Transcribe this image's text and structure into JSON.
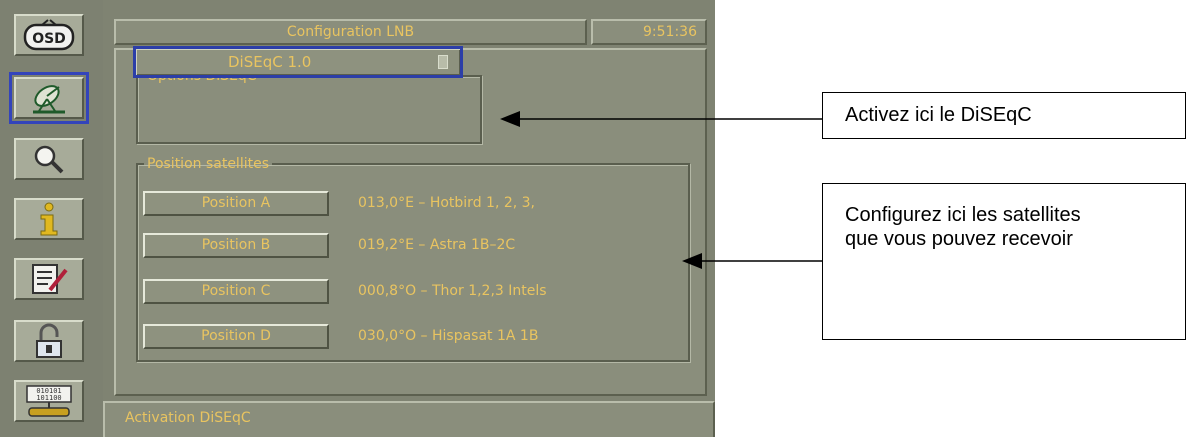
{
  "sidebar": {
    "items": [
      {
        "name": "osd-icon",
        "label": "OSD"
      },
      {
        "name": "satellite-dish-icon"
      },
      {
        "name": "magnifier-icon"
      },
      {
        "name": "info-icon"
      },
      {
        "name": "edit-document-icon"
      },
      {
        "name": "lock-icon"
      },
      {
        "name": "data-transfer-icon"
      }
    ],
    "selected_index": 1
  },
  "header": {
    "title": "Configuration LNB",
    "clock": "9:51:36"
  },
  "diseqc": {
    "group_label": "Options DiSEqC",
    "selected_value": "DiSEqC 1.0"
  },
  "positions": {
    "group_label": "Position satellites",
    "items": [
      {
        "button": "Position A",
        "satellite": "013,0°E – Hotbird 1, 2, 3,"
      },
      {
        "button": "Position B",
        "satellite": "019,2°E – Astra 1B–2C"
      },
      {
        "button": "Position C",
        "satellite": "000,8°O – Thor 1,2,3 Intels"
      },
      {
        "button": "Position D",
        "satellite": "030,0°O – Hispasat 1A 1B"
      }
    ]
  },
  "status_bar": "Activation DiSEqC",
  "annotations": {
    "diseqc_note": "Activez ici le DiSEqC",
    "satellites_note_line1": "Configurez ici les satellites",
    "satellites_note_line2": "que vous pouvez recevoir"
  },
  "colors": {
    "osd_text": "#e9c460",
    "panel_bg": "#8a8e7c",
    "selection_border": "#2c3ea8"
  }
}
